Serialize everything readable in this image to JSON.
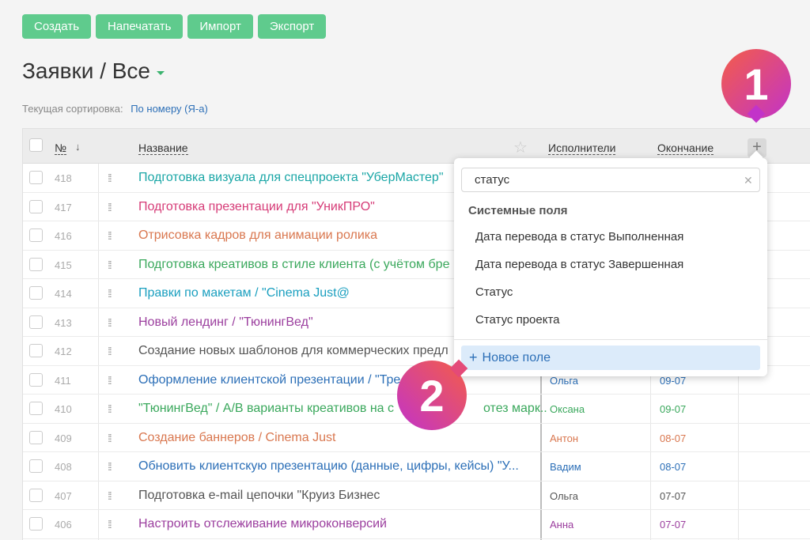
{
  "toolbar": {
    "create": "Создать",
    "print": "Напечатать",
    "import": "Импорт",
    "export": "Экспорт"
  },
  "page_title": "Заявки / Все",
  "sort": {
    "label": "Текущая сортировка:",
    "value": "По номеру (Я-а)"
  },
  "columns": {
    "number": "№",
    "name": "Название",
    "assignees": "Исполнители",
    "end": "Окончание"
  },
  "rows": [
    {
      "num": "418",
      "name": "Подготовка визуала для спецпроекта \"УберМастер\"",
      "color": "#1aa6a6",
      "assignee": "",
      "end": ""
    },
    {
      "num": "417",
      "name": "Подготовка презентации для \"УникПРО\"",
      "color": "#d63b77",
      "assignee": "",
      "end": ""
    },
    {
      "num": "416",
      "name": "Отрисовка кадров для анимации ролика",
      "color": "#d9774f",
      "assignee": "",
      "end": ""
    },
    {
      "num": "415",
      "name": "Подготовка креативов в стиле клиента (с учётом бре",
      "color": "#3aa85c",
      "assignee": "",
      "end": ""
    },
    {
      "num": "414",
      "name": "Правки по макетам / \"Cinema Just@",
      "color": "#1a9fbf",
      "assignee": "",
      "end": ""
    },
    {
      "num": "413",
      "name": "Новый лендинг / \"ТюнингВед\"",
      "color": "#9b3e9e",
      "assignee": "",
      "end": ""
    },
    {
      "num": "412",
      "name": "Создание новых шаблонов для коммерческих предл",
      "color": "#555555",
      "assignee": "",
      "end": ""
    },
    {
      "num": "411",
      "name": "Оформление клиентской презентации / \"Тре",
      "color": "#2c6fb7",
      "assignee": "Ольга",
      "end": "09-07"
    },
    {
      "num": "410",
      "name": "\"ТюнингВед\" / A/B варианты креативов на с",
      "color": "#3aa85c",
      "assignee": "Оксана",
      "end": "09-07",
      "tail": "отез марк..."
    },
    {
      "num": "409",
      "name": "Создание баннеров / Cinema Just",
      "color": "#d9774f",
      "assignee": "Антон",
      "end": "08-07"
    },
    {
      "num": "408",
      "name": "Обновить клиентскую презентацию (данные, цифры, кейсы) \"У...",
      "color": "#2c6fb7",
      "assignee": "Вадим",
      "end": "08-07"
    },
    {
      "num": "407",
      "name": "Подготовка e-mail цепочки \"Круиз Бизнес",
      "color": "#555555",
      "assignee": "Ольга",
      "end": "07-07"
    },
    {
      "num": "406",
      "name": "Настроить отслеживание микроконверсий",
      "color": "#9b3e9e",
      "assignee": "Анна",
      "end": "07-07"
    }
  ],
  "popup": {
    "search_value": "статус",
    "group": "Системные поля",
    "options": [
      "Дата перевода в статус Выполненная",
      "Дата перевода в статус Завершенная",
      "Статус",
      "Статус проекта"
    ],
    "new_field": "Новое поле"
  },
  "badges": {
    "one": "1",
    "two": "2"
  }
}
